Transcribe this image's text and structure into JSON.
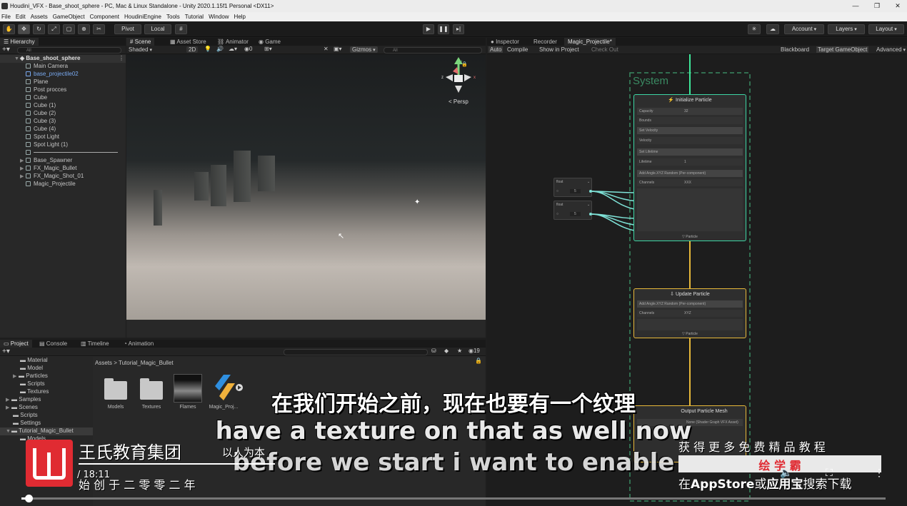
{
  "window": {
    "title": "Houdini_VFX - Base_shoot_sphere - PC, Mac & Linux Standalone - Unity 2020.1.15f1 Personal <DX11>",
    "minimize": "—",
    "maximize": "❐",
    "close": "✕"
  },
  "menu": [
    "File",
    "Edit",
    "Assets",
    "GameObject",
    "Component",
    "HoudiniEngine",
    "Tools",
    "Tutorial",
    "Window",
    "Help"
  ],
  "toolbar": {
    "pivot": "Pivot",
    "local": "Local",
    "account": "Account",
    "layers": "Layers",
    "layout": "Layout"
  },
  "hierarchy": {
    "tab": "Hierarchy",
    "search_placeholder": "All",
    "scene": "Base_shoot_sphere",
    "items": [
      "Main Camera",
      "base_projectile02",
      "Plane",
      "Post procces",
      "Cube",
      "Cube (1)",
      "Cube (2)",
      "Cube (3)",
      "Cube (4)",
      "Spot Light",
      "Spot Light (1)",
      "",
      "Base_Spawner",
      "FX_Magic_Bullet",
      "FX_Magic_Shot_01",
      "Magic_Projectile"
    ]
  },
  "scene": {
    "tabs": [
      "Scene",
      "Asset Store",
      "Animator",
      "Game"
    ],
    "shading": "Shaded",
    "mode": "2D",
    "gizmos": "Gizmos",
    "search_placeholder": "All",
    "persp": "< Persp",
    "axis_x": "x",
    "axis_y": "y",
    "axis_z": "z"
  },
  "inspector": {
    "tabs": [
      "Inspector",
      "Recorder",
      "Magic_Projectile*"
    ],
    "auto": "Auto",
    "compile": "Compile",
    "show_in_project": "Show in Project",
    "check_out": "Check Out",
    "blackboard": "Blackboard",
    "target": "Target GameObject",
    "advanced": "Advanced"
  },
  "vfx": {
    "system": "System",
    "init": {
      "title": "Initialize Particle",
      "rows": [
        "Capacity",
        "Bounds",
        "Set Velocity",
        "Velocity",
        "Set Lifetime",
        "Lifetime",
        "Add Angle.XYZ Random (Per-component)",
        "Channels"
      ],
      "capacity": "32",
      "lifetime": "1",
      "channels": "XXX",
      "footer": "Particle"
    },
    "update": {
      "title": "Update Particle",
      "block": "Add Angle.XYZ Random (Per-component)",
      "channels_label": "Channels",
      "channels": "XYZ",
      "footer": "Particle"
    },
    "output": {
      "title": "Output Particle Mesh",
      "row": "None (Shader Graph VFX Asset)"
    },
    "float_node": "float",
    "float_value": "5"
  },
  "project": {
    "tabs": [
      "Project",
      "Console",
      "Timeline",
      "Animation"
    ],
    "tree": [
      "Material",
      "Model",
      "Particles",
      "Scripts",
      "Textures",
      "Samples",
      "Scenes",
      "Scripts",
      "Settings",
      "Tutorial_Magic_Bullet",
      "Models"
    ],
    "breadcrumb": "Assets > Tutorial_Magic_Bullet",
    "items": [
      "Models",
      "Textures",
      "Flames",
      "Magic_Proj..."
    ],
    "count": "19"
  },
  "overlay": {
    "subtitle_cn": "在我们开始之前，现在也要有一个纹理",
    "subtitle_en1": "have a texture on that as well now",
    "subtitle_en2": "before we start i want to enable",
    "logo_name": "王氏教育集团",
    "logo_motto": "以人为本",
    "founded": "始 创 于 二 零 零 二 年",
    "time": "/ 18:11",
    "promo1": "获 得 更 多 免 费 精 品 教 程",
    "promo_app": "绘 学 霸",
    "promo2_pre": "在",
    "promo2_store": "AppStore",
    "promo2_mid": "或",
    "promo2_app": "应用宝",
    "promo2_post": "搜索下载"
  },
  "colors": {
    "init_border": "#3dd6a4",
    "update_border": "#e8b93a",
    "output_border": "#e8b93a",
    "link_green": "#3ee89a",
    "link_cyan": "#7fe3d8",
    "system_dash": "#3a8a62",
    "logo_red": "#e02b32"
  }
}
